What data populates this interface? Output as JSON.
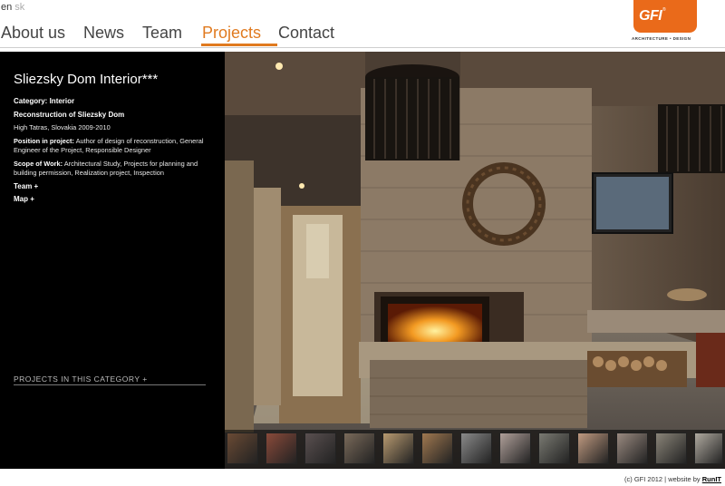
{
  "lang": {
    "en": "en",
    "sk": "sk"
  },
  "nav": [
    {
      "label": "About us",
      "active": false
    },
    {
      "label": "News",
      "active": false
    },
    {
      "label": "Team",
      "active": false
    },
    {
      "label": "Projects",
      "active": true
    },
    {
      "label": "Contact",
      "active": false
    }
  ],
  "logo": {
    "mark": "GFI",
    "reg": "®",
    "sub": "ARCHITECTURE • DESIGN"
  },
  "project": {
    "title": "Sliezsky Dom Interior***",
    "category_label": "Category:",
    "category_value": "Interior",
    "name": "Reconstruction of Sliezsky Dom",
    "place": "High Tatras, Slovakia 2009-2010",
    "position_label": "Position in project:",
    "position_value": "Author of design of reconstruction, General Engineer of the Project, Responsible Designer",
    "scope_label": "Scope of Work:",
    "scope_value": "Architectural Study, Projects for planning and building permission, Realization project, Inspection",
    "team_toggle": "Team +",
    "map_toggle": "Map +"
  },
  "projects_in_category": "PROJECTS IN THIS CATEGORY +",
  "thumbnails": [
    {
      "color": "#6a4a34"
    },
    {
      "color": "#8a4a3a"
    },
    {
      "color": "#5a5050"
    },
    {
      "color": "#7a6a5a"
    },
    {
      "color": "#b89a70"
    },
    {
      "color": "#a07850"
    },
    {
      "color": "#8a8a8a"
    },
    {
      "color": "#b0a09a"
    },
    {
      "color": "#7a7a72"
    },
    {
      "color": "#c09a80"
    },
    {
      "color": "#9a8a80"
    },
    {
      "color": "#8a8478"
    },
    {
      "color": "#b0aaa0"
    }
  ],
  "footer": {
    "text": "(c) GFI 2012 | website by",
    "link": "RunIT"
  }
}
